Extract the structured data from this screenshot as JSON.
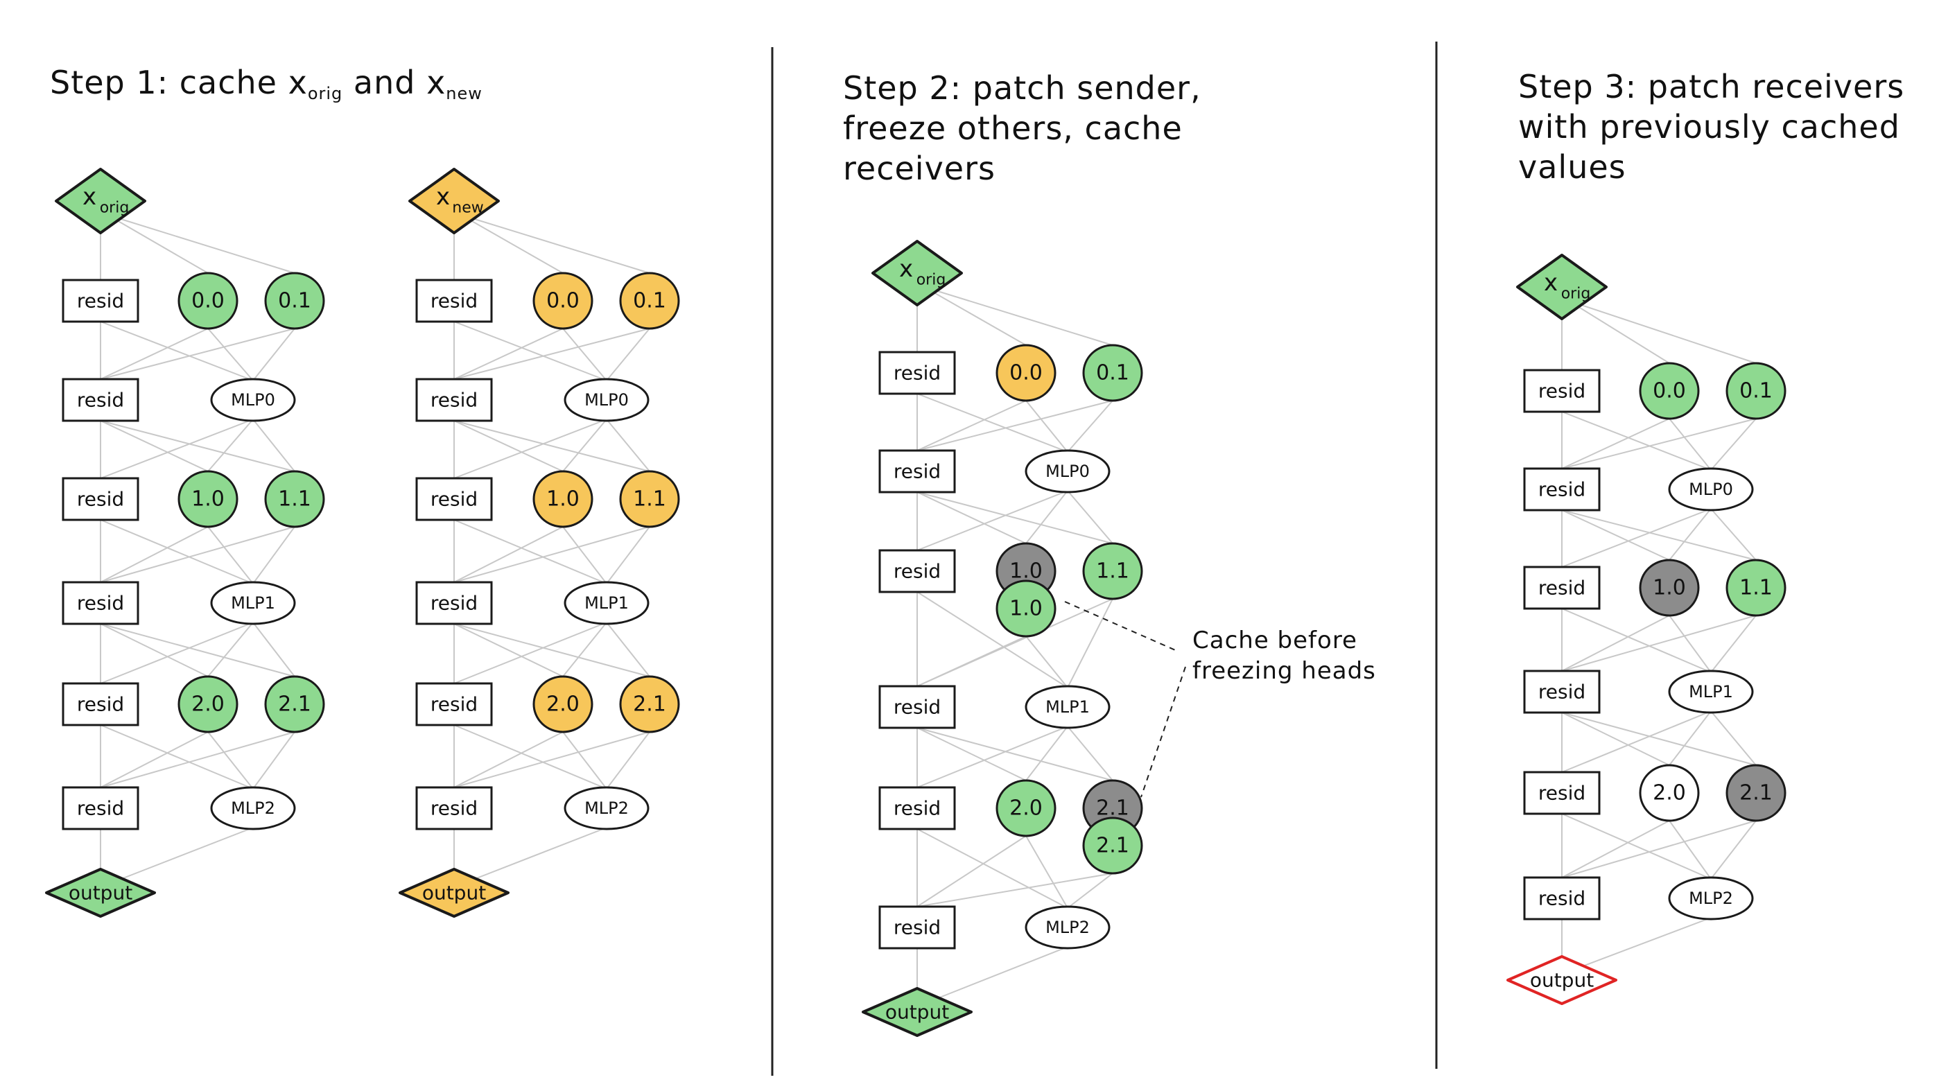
{
  "colors": {
    "green": "#8ed990",
    "orange": "#f7c65a",
    "gray": "#8c8c8c",
    "white": "#ffffff",
    "red_outline": "#e02424",
    "edge": "#c8c8c8"
  },
  "step1": {
    "title_pre": "Step 1: cache x",
    "title_sub1": "orig",
    "title_mid": " and x",
    "title_sub2": "new"
  },
  "step2": {
    "title": "Step 2: patch sender,\nfreeze others, cache\nreceivers"
  },
  "step3": {
    "title": "Step 3: patch receivers\nwith previously cached\nvalues"
  },
  "annotation": "Cache before\nfreezing heads",
  "columns": [
    {
      "id": "step1-orig",
      "input": {
        "label": "x",
        "sub": "orig",
        "color": "green"
      },
      "rows": [
        {
          "resid": "resid",
          "heads": [
            {
              "label": "0.0",
              "color": "green"
            },
            {
              "label": "0.1",
              "color": "green"
            }
          ]
        },
        {
          "resid": "resid",
          "mlp": "MLP0"
        },
        {
          "resid": "resid",
          "heads": [
            {
              "label": "1.0",
              "color": "green"
            },
            {
              "label": "1.1",
              "color": "green"
            }
          ]
        },
        {
          "resid": "resid",
          "mlp": "MLP1"
        },
        {
          "resid": "resid",
          "heads": [
            {
              "label": "2.0",
              "color": "green"
            },
            {
              "label": "2.1",
              "color": "green"
            }
          ]
        },
        {
          "resid": "resid",
          "mlp": "MLP2"
        }
      ],
      "output": {
        "label": "output",
        "color": "green"
      }
    },
    {
      "id": "step1-new",
      "input": {
        "label": "x",
        "sub": "new",
        "color": "orange"
      },
      "rows": [
        {
          "resid": "resid",
          "heads": [
            {
              "label": "0.0",
              "color": "orange"
            },
            {
              "label": "0.1",
              "color": "orange"
            }
          ]
        },
        {
          "resid": "resid",
          "mlp": "MLP0"
        },
        {
          "resid": "resid",
          "heads": [
            {
              "label": "1.0",
              "color": "orange"
            },
            {
              "label": "1.1",
              "color": "orange"
            }
          ]
        },
        {
          "resid": "resid",
          "mlp": "MLP1"
        },
        {
          "resid": "resid",
          "heads": [
            {
              "label": "2.0",
              "color": "orange"
            },
            {
              "label": "2.1",
              "color": "orange"
            }
          ]
        },
        {
          "resid": "resid",
          "mlp": "MLP2"
        }
      ],
      "output": {
        "label": "output",
        "color": "orange"
      }
    },
    {
      "id": "step2",
      "input": {
        "label": "x",
        "sub": "orig",
        "color": "green"
      },
      "rows": [
        {
          "resid": "resid",
          "heads": [
            {
              "label": "0.0",
              "color": "orange"
            },
            {
              "label": "0.1",
              "color": "green"
            }
          ]
        },
        {
          "resid": "resid",
          "mlp": "MLP0"
        },
        {
          "resid": "resid",
          "heads": [
            {
              "label": "1.0",
              "color": "gray",
              "cached": {
                "label": "1.0",
                "color": "green"
              }
            },
            {
              "label": "1.1",
              "color": "green"
            }
          ]
        },
        {
          "resid": "resid",
          "mlp": "MLP1"
        },
        {
          "resid": "resid",
          "heads": [
            {
              "label": "2.0",
              "color": "green"
            },
            {
              "label": "2.1",
              "color": "gray",
              "cached": {
                "label": "2.1",
                "color": "green"
              }
            }
          ]
        },
        {
          "resid": "resid",
          "mlp": "MLP2"
        }
      ],
      "output": {
        "label": "output",
        "color": "green"
      }
    },
    {
      "id": "step3",
      "input": {
        "label": "x",
        "sub": "orig",
        "color": "green"
      },
      "rows": [
        {
          "resid": "resid",
          "heads": [
            {
              "label": "0.0",
              "color": "green"
            },
            {
              "label": "0.1",
              "color": "green"
            }
          ]
        },
        {
          "resid": "resid",
          "mlp": "MLP0"
        },
        {
          "resid": "resid",
          "heads": [
            {
              "label": "1.0",
              "color": "gray"
            },
            {
              "label": "1.1",
              "color": "green"
            }
          ]
        },
        {
          "resid": "resid",
          "mlp": "MLP1"
        },
        {
          "resid": "resid",
          "heads": [
            {
              "label": "2.0",
              "color": "white"
            },
            {
              "label": "2.1",
              "color": "gray"
            }
          ]
        },
        {
          "resid": "resid",
          "mlp": "MLP2"
        }
      ],
      "output": {
        "label": "output",
        "color": "red_outline"
      }
    }
  ]
}
